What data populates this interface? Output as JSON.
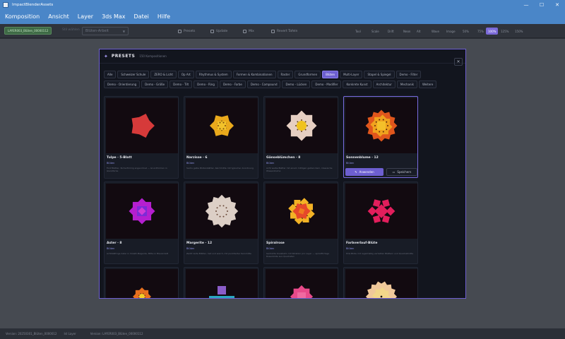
{
  "window": {
    "title": "ImpactBlenderAssets",
    "btn_min": "—",
    "btn_max": "☐",
    "btn_close": "✕"
  },
  "menu": [
    "Komposition",
    "Ansicht",
    "Layer",
    "3ds Max",
    "Datei",
    "Hilfe"
  ],
  "toolbar": {
    "version_badge": "LAYER003_Blüten_00000112",
    "muted_label": "Stil wählen",
    "select_value": "Blüten-Arbeit",
    "mid_buttons": [
      "Presets",
      "Update",
      "Mix",
      "Revert Tafeln"
    ],
    "small_buttons": [
      "Tool",
      "Scale",
      "Drift",
      "Neon",
      "Alt",
      "Wave",
      "Image",
      "50%",
      "75%",
      "100%",
      "125%",
      "150%"
    ],
    "active_small": "100%"
  },
  "dialog": {
    "title": "PRESETS",
    "count": "150 Kompositionen",
    "close": "✕",
    "chips": [
      "Alle",
      "Schweizer Schule",
      "ZERO & Licht",
      "Op Art",
      "Rhythmus & System",
      "Formen & Kombinationen",
      "Raster",
      "Grundformen",
      "Blüten",
      "Multi-Layer",
      "Stapel & Spiegel",
      "Demo - Filter",
      "Demo - Orientierung",
      "Demo - Größe",
      "Demo - Tilt",
      "Demo - Ring",
      "Demo - Farbe",
      "Demo - Compound",
      "Demo - Lücken",
      "Demo - Modifier",
      "Konkrete Kunst",
      "Architektur",
      "Mechanik",
      "Weitere"
    ],
    "active_chip": "Blüten",
    "apply_label": "Anwenden",
    "save_label": "Speichern",
    "cards": [
      {
        "name": "Tulpe · 5-Blatt",
        "category": "Blüten",
        "desc": "Fünf Blätter, fächerförmig angeordnet — Grundformen in Glanzfarbe"
      },
      {
        "name": "Narzisse · 6",
        "category": "Blüten",
        "desc": "Sechs gelbe Blütenblätter, Kelchmitte mit typischer Anordnung"
      },
      {
        "name": "Gänseblümchen · 8",
        "category": "Blüten",
        "desc": "Acht weiße Blätter mit einem mittigen gelben Kern, klassische Wiesenblume"
      },
      {
        "name": "Sonnenblume · 12",
        "category": "Blüten",
        "desc": ""
      },
      {
        "name": "Aster · 8",
        "category": "Blüten",
        "desc": "Achtblättrige Aster in Violett-Magenta, Mitte in Blauviolett"
      },
      {
        "name": "Margerite · 12",
        "category": "Blüten",
        "desc": "Zwölf zarte Blätter, hell und weich, mit punktierter Kernmitte"
      },
      {
        "name": "Spiralrose",
        "category": "Blüten",
        "desc": "Gedrehte Kreisbahn mit Rotation pro Layer — spiralförmige Rosenblüte aus Quadraten"
      },
      {
        "name": "Farbverlauf-Blüte",
        "category": "Blüten",
        "desc": "Pink-Blüte mit regelmäßig verteilten Blättern und Quadratmitte"
      },
      {
        "name": "",
        "category": "",
        "desc": ""
      },
      {
        "name": "",
        "category": "",
        "desc": ""
      },
      {
        "name": "",
        "category": "",
        "desc": ""
      },
      {
        "name": "",
        "category": "",
        "desc": ""
      }
    ]
  },
  "status": {
    "left": "Version: 20250301_Blüten_0000012",
    "mid": "Ist Layer",
    "right": "Version: LAYER003_Blüten_00000112"
  },
  "colors": {
    "accent": "#6d5fd0",
    "titlebar": "#4a86c8"
  }
}
